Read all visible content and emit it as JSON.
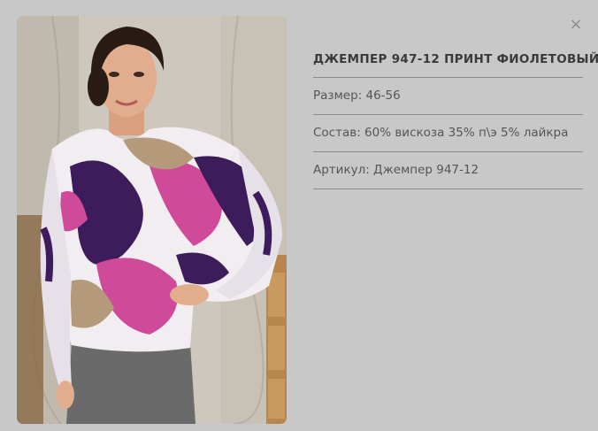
{
  "product": {
    "title": "ДЖЕМПЕР 947-12 ПРИНТ ФИОЛЕТОВЫЙ",
    "size": "Размер: 46-56",
    "composition": "Состав: 60% вискоза 35% п\\э 5% лайкра",
    "article": "Артикул: Джемпер 947-12"
  },
  "close_icon": "close-icon",
  "colors": {
    "background": "#c8c8c8",
    "divider": "#8c8c8c",
    "print_purple": "#3d1c5c",
    "print_pink": "#d04a9a"
  }
}
